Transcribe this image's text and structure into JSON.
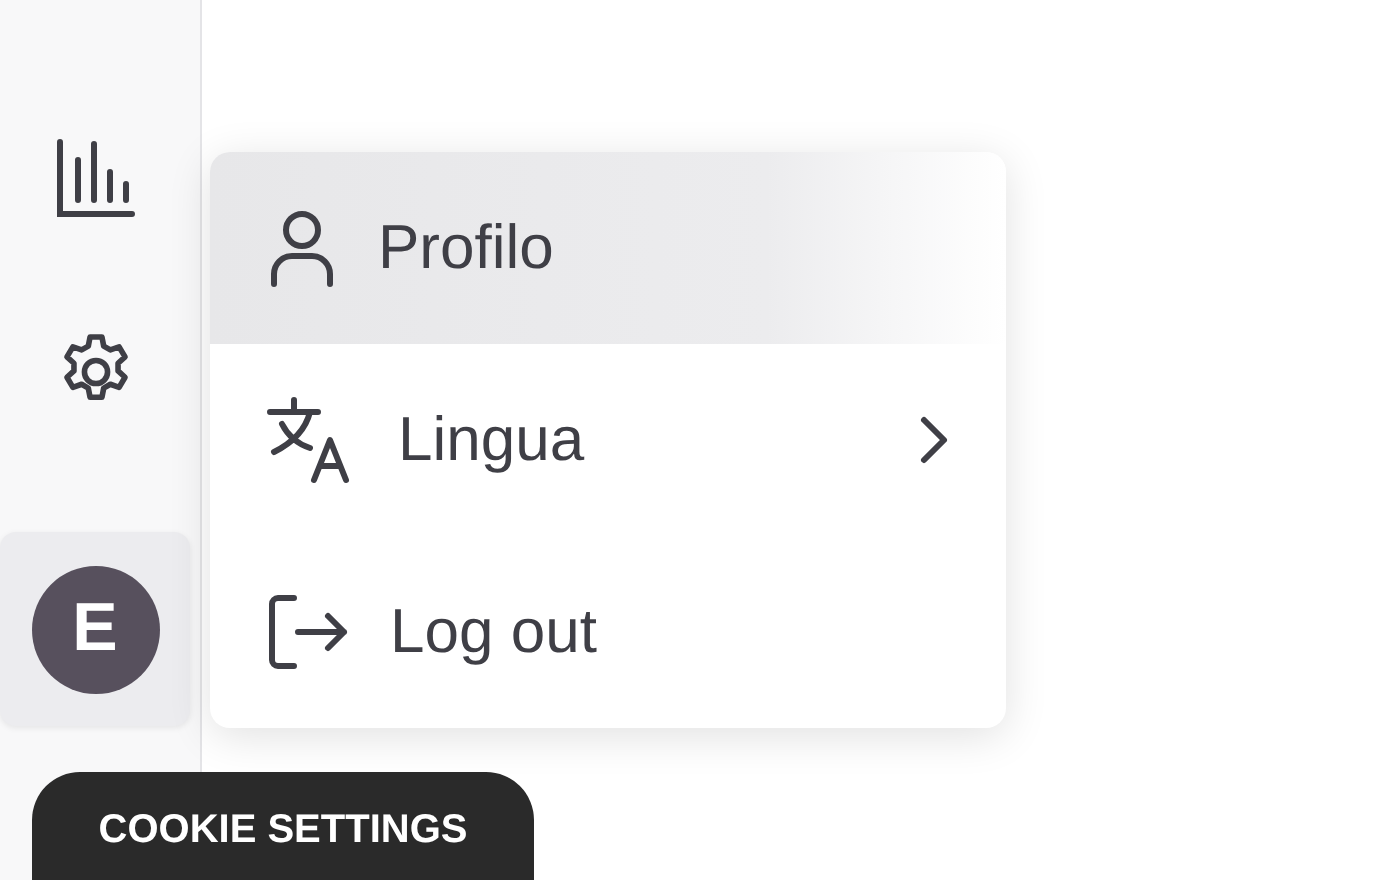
{
  "sidebar": {
    "items": [
      {
        "kind": "chart",
        "selected": false
      },
      {
        "kind": "settings",
        "selected": false
      },
      {
        "kind": "avatar",
        "selected": true,
        "initial": "E"
      }
    ]
  },
  "menu": {
    "items": [
      {
        "label": "Profilo",
        "kind": "person",
        "selected": true,
        "has_submenu": false
      },
      {
        "label": "Lingua",
        "kind": "translate",
        "selected": false,
        "has_submenu": true
      },
      {
        "label": "Log out",
        "kind": "logout",
        "selected": false,
        "has_submenu": false
      }
    ]
  },
  "cookie_button": {
    "label": "COOKIE SETTINGS"
  }
}
